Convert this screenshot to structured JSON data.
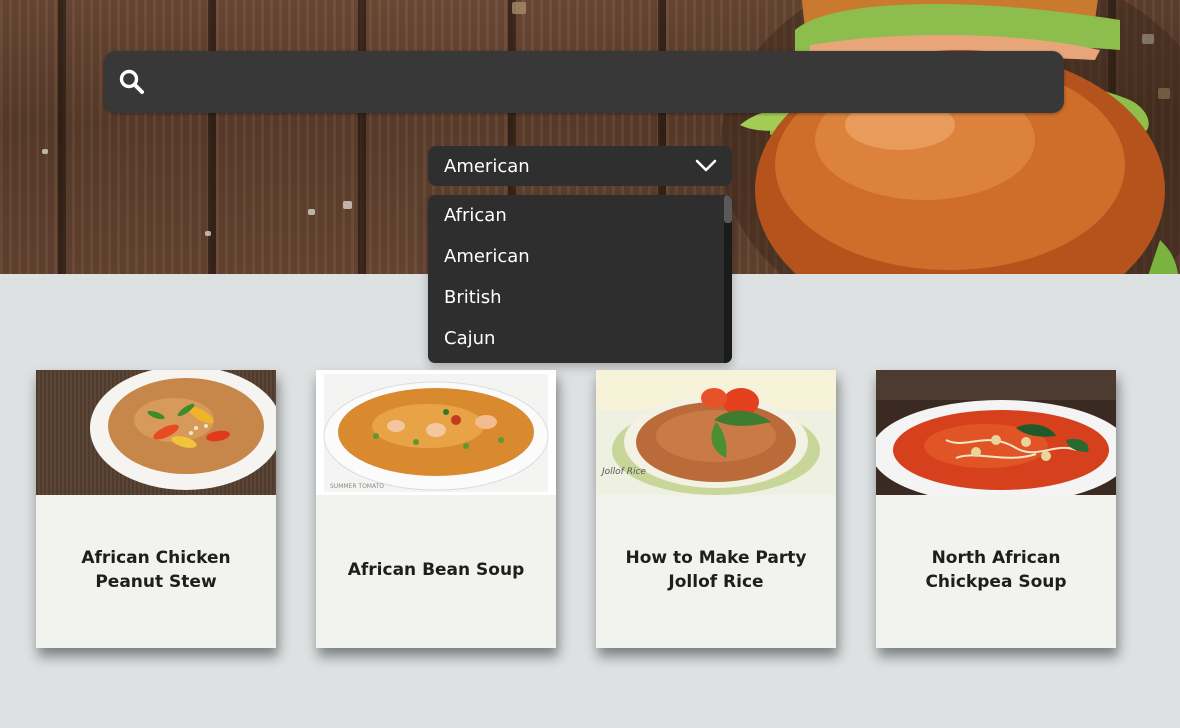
{
  "search": {
    "placeholder": "",
    "value": ""
  },
  "cuisine_filter": {
    "selected": "American",
    "options": [
      "African",
      "American",
      "British",
      "Cajun"
    ]
  },
  "recipes": [
    {
      "title": "African Chicken Peanut Stew"
    },
    {
      "title": "African Bean Soup"
    },
    {
      "title": "How to Make Party Jollof Rice"
    },
    {
      "title": "North African Chickpea Soup"
    }
  ],
  "image_overlays": {
    "bean_soup_watermark": "SUMMER TOMATO",
    "jollof_watermark": "Jollof Rice"
  },
  "colors": {
    "background": "#dde1e2",
    "search_bar": "#383838",
    "dropdown": "#2f2f2f",
    "card": "#f2f2ee",
    "text_dark": "#1e1e1e"
  },
  "icons": {
    "search": "search-icon",
    "dropdown": "chevron-down-icon"
  }
}
